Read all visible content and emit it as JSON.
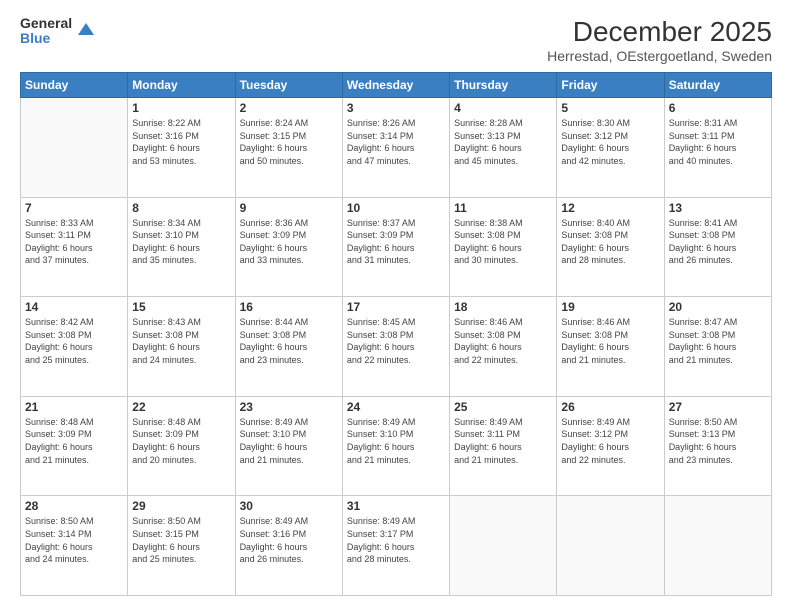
{
  "header": {
    "logo_general": "General",
    "logo_blue": "Blue",
    "title": "December 2025",
    "subtitle": "Herrestad, OEstergoetland, Sweden"
  },
  "calendar": {
    "days_of_week": [
      "Sunday",
      "Monday",
      "Tuesday",
      "Wednesday",
      "Thursday",
      "Friday",
      "Saturday"
    ],
    "weeks": [
      [
        {
          "day": "",
          "info": ""
        },
        {
          "day": "1",
          "info": "Sunrise: 8:22 AM\nSunset: 3:16 PM\nDaylight: 6 hours\nand 53 minutes."
        },
        {
          "day": "2",
          "info": "Sunrise: 8:24 AM\nSunset: 3:15 PM\nDaylight: 6 hours\nand 50 minutes."
        },
        {
          "day": "3",
          "info": "Sunrise: 8:26 AM\nSunset: 3:14 PM\nDaylight: 6 hours\nand 47 minutes."
        },
        {
          "day": "4",
          "info": "Sunrise: 8:28 AM\nSunset: 3:13 PM\nDaylight: 6 hours\nand 45 minutes."
        },
        {
          "day": "5",
          "info": "Sunrise: 8:30 AM\nSunset: 3:12 PM\nDaylight: 6 hours\nand 42 minutes."
        },
        {
          "day": "6",
          "info": "Sunrise: 8:31 AM\nSunset: 3:11 PM\nDaylight: 6 hours\nand 40 minutes."
        }
      ],
      [
        {
          "day": "7",
          "info": "Sunrise: 8:33 AM\nSunset: 3:11 PM\nDaylight: 6 hours\nand 37 minutes."
        },
        {
          "day": "8",
          "info": "Sunrise: 8:34 AM\nSunset: 3:10 PM\nDaylight: 6 hours\nand 35 minutes."
        },
        {
          "day": "9",
          "info": "Sunrise: 8:36 AM\nSunset: 3:09 PM\nDaylight: 6 hours\nand 33 minutes."
        },
        {
          "day": "10",
          "info": "Sunrise: 8:37 AM\nSunset: 3:09 PM\nDaylight: 6 hours\nand 31 minutes."
        },
        {
          "day": "11",
          "info": "Sunrise: 8:38 AM\nSunset: 3:08 PM\nDaylight: 6 hours\nand 30 minutes."
        },
        {
          "day": "12",
          "info": "Sunrise: 8:40 AM\nSunset: 3:08 PM\nDaylight: 6 hours\nand 28 minutes."
        },
        {
          "day": "13",
          "info": "Sunrise: 8:41 AM\nSunset: 3:08 PM\nDaylight: 6 hours\nand 26 minutes."
        }
      ],
      [
        {
          "day": "14",
          "info": "Sunrise: 8:42 AM\nSunset: 3:08 PM\nDaylight: 6 hours\nand 25 minutes."
        },
        {
          "day": "15",
          "info": "Sunrise: 8:43 AM\nSunset: 3:08 PM\nDaylight: 6 hours\nand 24 minutes."
        },
        {
          "day": "16",
          "info": "Sunrise: 8:44 AM\nSunset: 3:08 PM\nDaylight: 6 hours\nand 23 minutes."
        },
        {
          "day": "17",
          "info": "Sunrise: 8:45 AM\nSunset: 3:08 PM\nDaylight: 6 hours\nand 22 minutes."
        },
        {
          "day": "18",
          "info": "Sunrise: 8:46 AM\nSunset: 3:08 PM\nDaylight: 6 hours\nand 22 minutes."
        },
        {
          "day": "19",
          "info": "Sunrise: 8:46 AM\nSunset: 3:08 PM\nDaylight: 6 hours\nand 21 minutes."
        },
        {
          "day": "20",
          "info": "Sunrise: 8:47 AM\nSunset: 3:08 PM\nDaylight: 6 hours\nand 21 minutes."
        }
      ],
      [
        {
          "day": "21",
          "info": "Sunrise: 8:48 AM\nSunset: 3:09 PM\nDaylight: 6 hours\nand 21 minutes."
        },
        {
          "day": "22",
          "info": "Sunrise: 8:48 AM\nSunset: 3:09 PM\nDaylight: 6 hours\nand 20 minutes."
        },
        {
          "day": "23",
          "info": "Sunrise: 8:49 AM\nSunset: 3:10 PM\nDaylight: 6 hours\nand 21 minutes."
        },
        {
          "day": "24",
          "info": "Sunrise: 8:49 AM\nSunset: 3:10 PM\nDaylight: 6 hours\nand 21 minutes."
        },
        {
          "day": "25",
          "info": "Sunrise: 8:49 AM\nSunset: 3:11 PM\nDaylight: 6 hours\nand 21 minutes."
        },
        {
          "day": "26",
          "info": "Sunrise: 8:49 AM\nSunset: 3:12 PM\nDaylight: 6 hours\nand 22 minutes."
        },
        {
          "day": "27",
          "info": "Sunrise: 8:50 AM\nSunset: 3:13 PM\nDaylight: 6 hours\nand 23 minutes."
        }
      ],
      [
        {
          "day": "28",
          "info": "Sunrise: 8:50 AM\nSunset: 3:14 PM\nDaylight: 6 hours\nand 24 minutes."
        },
        {
          "day": "29",
          "info": "Sunrise: 8:50 AM\nSunset: 3:15 PM\nDaylight: 6 hours\nand 25 minutes."
        },
        {
          "day": "30",
          "info": "Sunrise: 8:49 AM\nSunset: 3:16 PM\nDaylight: 6 hours\nand 26 minutes."
        },
        {
          "day": "31",
          "info": "Sunrise: 8:49 AM\nSunset: 3:17 PM\nDaylight: 6 hours\nand 28 minutes."
        },
        {
          "day": "",
          "info": ""
        },
        {
          "day": "",
          "info": ""
        },
        {
          "day": "",
          "info": ""
        }
      ]
    ]
  }
}
